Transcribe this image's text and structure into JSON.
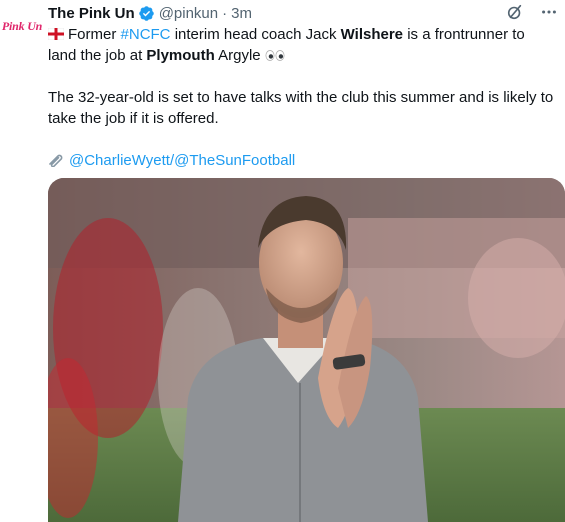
{
  "account": {
    "avatar_text": "Pink Un",
    "display_name": "The Pink Un",
    "handle": "@pinkun",
    "separator": "·",
    "time": "3m"
  },
  "icons": {
    "verified": "verified-badge-icon",
    "grok": "grok-icon",
    "more": "more-icon",
    "flag": "england-flag-emoji",
    "eyes": "eyes-emoji",
    "clip": "paperclip-emoji"
  },
  "tweet": {
    "line1_former": "Former",
    "hashtag": "#NCFC",
    "line1_mid": "interim head coach Jack",
    "wilshere": "Wilshere",
    "line1_end": "is a frontrunner to land the job at",
    "plymouth": "Plymouth",
    "argyle": "Argyle",
    "eyes_glyph": "👀",
    "paragraph2": "The 32-year-old is set to have talks with the club this summer and is likely to take the job if it is offered.",
    "mention1": "@CharlieWyett",
    "slash": "/",
    "mention2": "@TheSunFootball"
  },
  "colors": {
    "link": "#1d9bf0",
    "brand_pink": "#e0266b",
    "verified": "#1d9bf0",
    "muted": "#536471"
  }
}
